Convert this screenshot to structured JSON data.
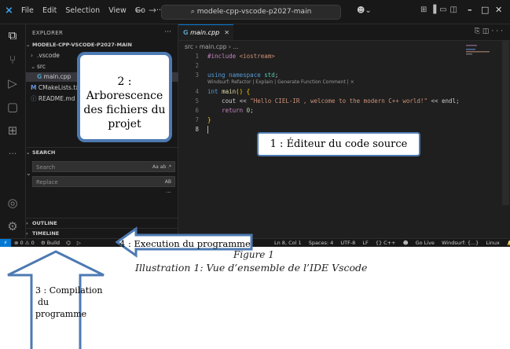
{
  "titlebar": {
    "menu": [
      "File",
      "Edit",
      "Selection",
      "View",
      "Go",
      "···"
    ],
    "search_text": "modele-cpp-vscode-p2027-main"
  },
  "explorer": {
    "title": "EXPLORER",
    "more": "···",
    "project": "MODELE-CPP-VSCODE-P2027-MAIN",
    "items": [
      {
        "label": ".vscode"
      },
      {
        "label": "src"
      },
      {
        "label": "main.cpp"
      },
      {
        "label": "CMakeLists.txt"
      },
      {
        "label": "README.md"
      }
    ]
  },
  "search_panel": {
    "title": "SEARCH",
    "search_placeholder": "Search",
    "search_flags": "Aa ab .*",
    "replace_placeholder": "Replace",
    "replace_flag": "AB",
    "more": "···"
  },
  "outline": {
    "label": "OUTLINE"
  },
  "timeline": {
    "label": "TIMELINE"
  },
  "editor": {
    "tab": "main.cpp",
    "breadcrumb": "src  ›  main.cpp  ›  ...",
    "codelens": "Windsurf: Refactor | Explain | Generate Function Comment | ×",
    "lines": [
      {
        "n": "1",
        "text": "#include <iostream>"
      },
      {
        "n": "2",
        "text": ""
      },
      {
        "n": "3",
        "text": "using namespace std;"
      },
      {
        "n": "4",
        "text": "int main() {"
      },
      {
        "n": "5",
        "text": "    cout << \"Hello CIEL-IR , welcome to the modern C++ world!\" << endl;"
      },
      {
        "n": "6",
        "text": "    return 0;"
      },
      {
        "n": "7",
        "text": "}"
      },
      {
        "n": "8",
        "text": ""
      }
    ]
  },
  "statusbar": {
    "errors": "⊗ 0 ⚠ 0",
    "build": "⚙ Build",
    "right": [
      "Ln 8, Col 1",
      "Spaces: 4",
      "UTF-8",
      "LF",
      "{} C++",
      "Go Live",
      "Windsurf: {...}",
      "Linux"
    ]
  },
  "annotations": {
    "c1": "1 : Éditeur du code source",
    "c2_line1": "2 : Arborescence",
    "c2_line2": "des fichiers du",
    "c2_line3": "projet",
    "c3_line1": "3 : Compilation",
    "c3_line2": "du",
    "c3_line3": "programme",
    "c4": "4 : Execution du programme"
  },
  "captions": {
    "figure": "Figure 1",
    "illustration": "Illustration 1: Vue d’ensemble de l’IDE Vscode"
  },
  "colors": {
    "accent": "#0078d4",
    "callout_border": "#4d7ab2"
  }
}
